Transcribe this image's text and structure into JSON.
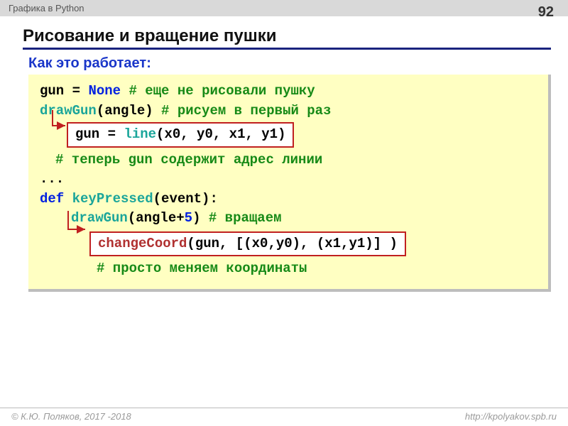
{
  "header": "Графика в Python",
  "slide_number": "92",
  "title": "Рисование и вращение пушки",
  "subtitle": "Как это работает:",
  "code": {
    "l1_var": "gun",
    "l1_eq": " = ",
    "l1_none": "None",
    "l1_cm": " # еще не рисовали пушку",
    "l2_fn": "drawGun",
    "l2_args": "(angle)  ",
    "l2_cm": "# рисуем в первый раз",
    "box1_var": "gun",
    "box1_eq": " = ",
    "box1_fn": "line",
    "box1_args": "(x0, y0, x1, y1)",
    "l3_cm": "# теперь gun содержит адрес линии",
    "l4": "...",
    "l5_def": "def",
    "l5_fn": " keyPressed",
    "l5_args": "(event):",
    "l6_fn": "drawGun",
    "l6_args1": "(angle+",
    "l6_five": "5",
    "l6_args2": ")  ",
    "l6_cm": "# вращаем",
    "box2_fn": "changeCoord",
    "box2_args": "(gun, [(x0,y0), (x1,y1)] )",
    "l7_cm": "# просто меняем координаты"
  },
  "footer_left": "© К.Ю. Поляков, 2017 -2018",
  "footer_right": "http://kpolyakov.spb.ru"
}
